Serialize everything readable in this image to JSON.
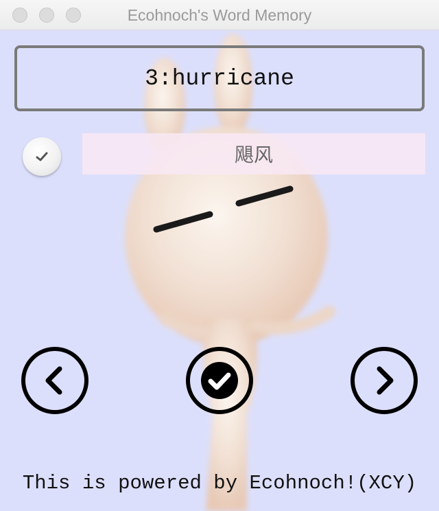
{
  "window": {
    "title": "Ecohnoch's Word Memory"
  },
  "card": {
    "index": "3:",
    "word": "hurricane",
    "meaning": "飓风"
  },
  "controls": {
    "remember_toggle": "check-icon",
    "prev_button": "chevron-left-icon",
    "done_button": "check-circle-icon",
    "next_button": "chevron-right-icon"
  },
  "footer": {
    "text": "This is powered by Ecohnoch!(XCY)"
  },
  "colors": {
    "background": "#dcdffb",
    "meaning_bg": "#f8e8f4",
    "border": "#7a7a7a"
  }
}
